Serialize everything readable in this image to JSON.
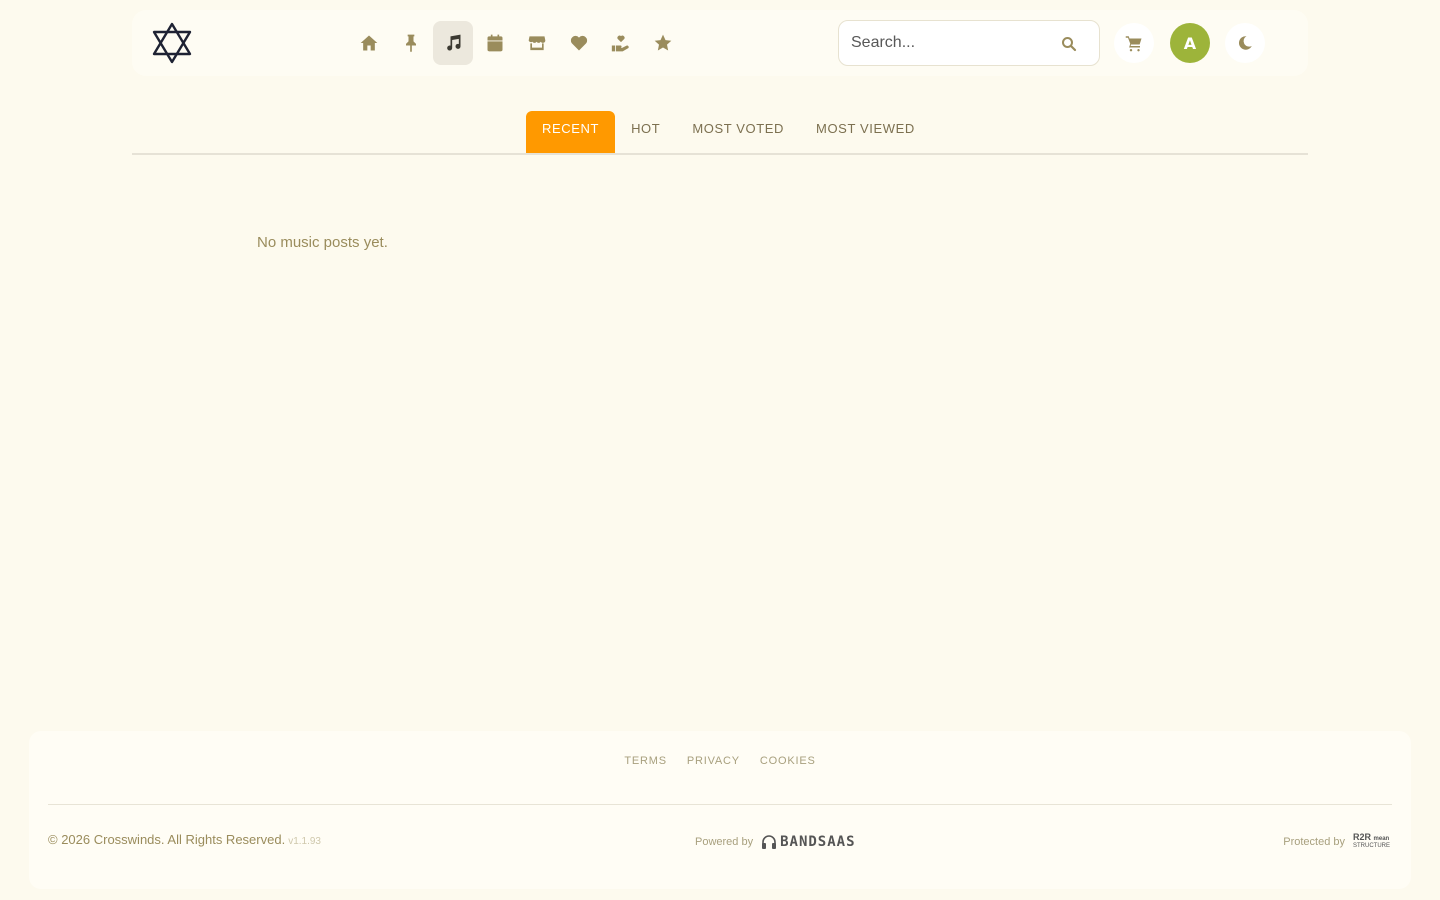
{
  "header": {
    "logo_icon": "crosswinds-logo-icon",
    "nav": [
      {
        "name": "home",
        "icon": "home-icon",
        "active": false
      },
      {
        "name": "pinned",
        "icon": "pushpin-icon",
        "active": false
      },
      {
        "name": "music",
        "icon": "music-note-icon",
        "active": true
      },
      {
        "name": "events",
        "icon": "calendar-icon",
        "active": false
      },
      {
        "name": "store",
        "icon": "store-icon",
        "active": false
      },
      {
        "name": "favorites",
        "icon": "heart-icon",
        "active": false
      },
      {
        "name": "donate",
        "icon": "hand-heart-icon",
        "active": false
      },
      {
        "name": "featured",
        "icon": "star-icon",
        "active": false
      }
    ],
    "search": {
      "placeholder": "Search...",
      "value": ""
    },
    "avatar_initial": "A",
    "accent_color": "#ff9900",
    "avatar_color": "#9db43a"
  },
  "tabs": [
    {
      "label": "RECENT",
      "active": true
    },
    {
      "label": "HOT",
      "active": false
    },
    {
      "label": "MOST VOTED",
      "active": false
    },
    {
      "label": "MOST VIEWED",
      "active": false
    }
  ],
  "main": {
    "empty_message": "No music posts yet."
  },
  "footer": {
    "links": [
      "TERMS",
      "PRIVACY",
      "COOKIES"
    ],
    "copyright": "© 2026 Crosswinds. All Rights Reserved.",
    "version": "v1.1.93",
    "powered_by": "Powered by",
    "powered_brand": "BANDSAAS",
    "protected_by": "Protected by",
    "protected_brand_top": "R2R",
    "protected_brand_side": "mean",
    "protected_brand_bottom": "STRUCTURE"
  }
}
